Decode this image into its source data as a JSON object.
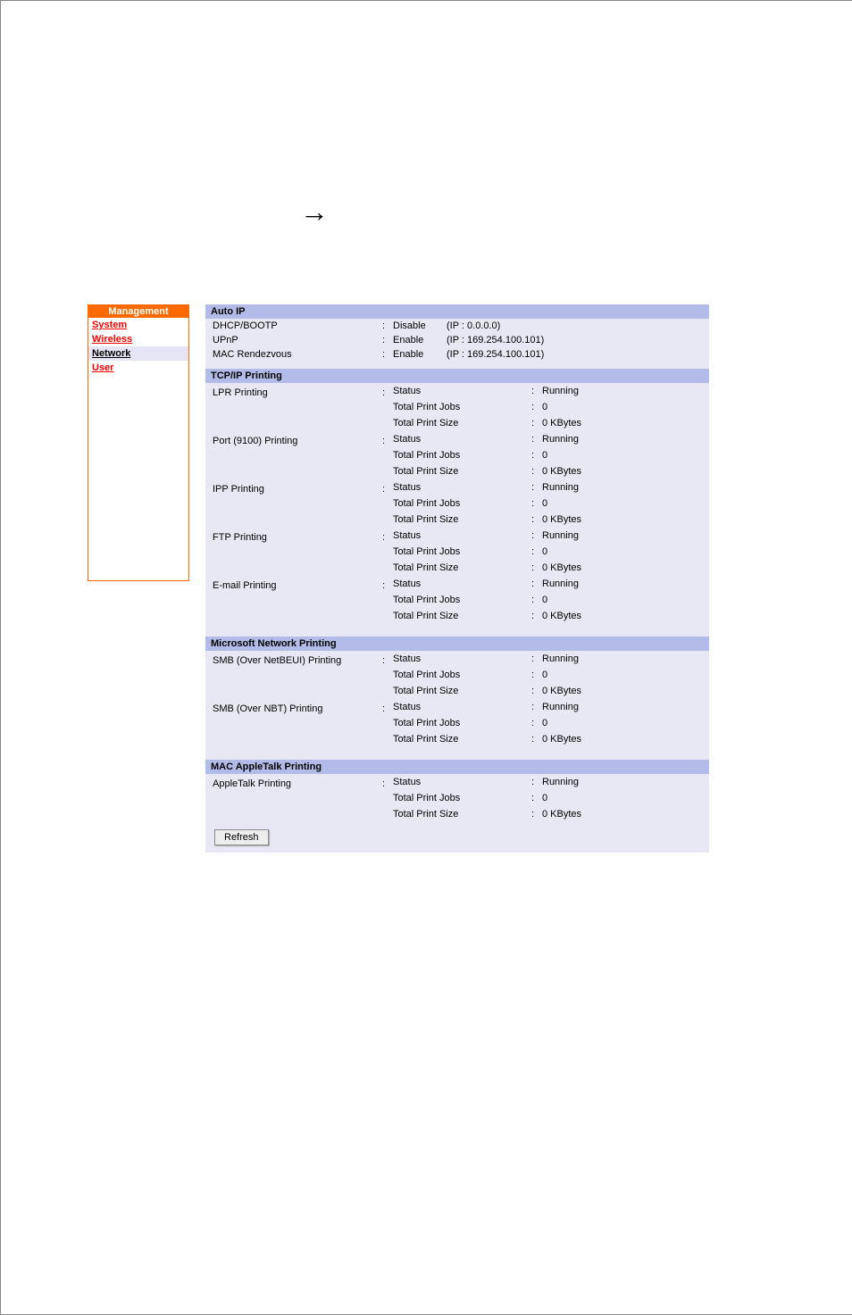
{
  "arrow": "→",
  "sidebar": {
    "header": "Management",
    "items": [
      {
        "label": "System",
        "active": false
      },
      {
        "label": "Wireless",
        "active": false
      },
      {
        "label": "Network",
        "active": true
      },
      {
        "label": "User",
        "active": false
      }
    ]
  },
  "sections": {
    "autoip": {
      "title": "Auto IP",
      "rows": [
        {
          "label": "DHCP/BOOTP",
          "state": "Disable",
          "ip": "(IP : 0.0.0.0)"
        },
        {
          "label": "UPnP",
          "state": "Enable",
          "ip": "(IP : 169.254.100.101)"
        },
        {
          "label": "MAC Rendezvous",
          "state": "Enable",
          "ip": "(IP : 169.254.100.101)"
        }
      ]
    },
    "tcpip": {
      "title": "TCP/IP Printing",
      "groups": [
        {
          "label": "LPR Printing",
          "details": [
            {
              "key": "Status",
              "val": "Running"
            },
            {
              "key": "Total Print Jobs",
              "val": "0"
            },
            {
              "key": "Total Print Size",
              "val": "0 KBytes"
            }
          ]
        },
        {
          "label": "Port (9100) Printing",
          "details": [
            {
              "key": "Status",
              "val": "Running"
            },
            {
              "key": "Total Print Jobs",
              "val": "0"
            },
            {
              "key": "Total Print Size",
              "val": "0 KBytes"
            }
          ]
        },
        {
          "label": "IPP Printing",
          "details": [
            {
              "key": "Status",
              "val": "Running"
            },
            {
              "key": "Total Print Jobs",
              "val": "0"
            },
            {
              "key": "Total Print Size",
              "val": "0 KBytes"
            }
          ]
        },
        {
          "label": "FTP Printing",
          "details": [
            {
              "key": "Status",
              "val": "Running"
            },
            {
              "key": "Total Print Jobs",
              "val": "0"
            },
            {
              "key": "Total Print Size",
              "val": "0 KBytes"
            }
          ]
        },
        {
          "label": "E-mail Printing",
          "details": [
            {
              "key": "Status",
              "val": "Running"
            },
            {
              "key": "Total Print Jobs",
              "val": "0"
            },
            {
              "key": "Total Print Size",
              "val": "0 KBytes"
            }
          ]
        }
      ]
    },
    "msnet": {
      "title": "Microsoft Network Printing",
      "groups": [
        {
          "label": "SMB (Over NetBEUI) Printing",
          "details": [
            {
              "key": "Status",
              "val": "Running"
            },
            {
              "key": "Total Print Jobs",
              "val": "0"
            },
            {
              "key": "Total Print Size",
              "val": "0 KBytes"
            }
          ]
        },
        {
          "label": "SMB (Over NBT) Printing",
          "details": [
            {
              "key": "Status",
              "val": "Running"
            },
            {
              "key": "Total Print Jobs",
              "val": "0"
            },
            {
              "key": "Total Print Size",
              "val": "0 KBytes"
            }
          ]
        }
      ]
    },
    "appletalk": {
      "title": "MAC AppleTalk Printing",
      "groups": [
        {
          "label": "AppleTalk Printing",
          "details": [
            {
              "key": "Status",
              "val": "Running"
            },
            {
              "key": "Total Print Jobs",
              "val": "0"
            },
            {
              "key": "Total Print Size",
              "val": "0 KBytes"
            }
          ]
        }
      ]
    }
  },
  "refresh_label": "Refresh"
}
